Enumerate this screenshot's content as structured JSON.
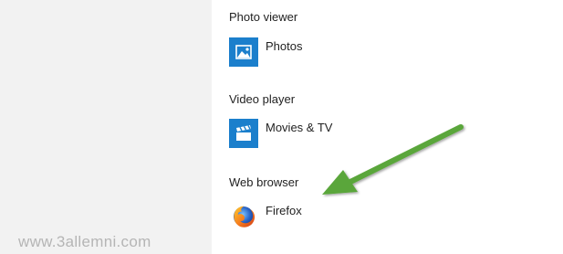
{
  "watermark": "www.3allemni.com",
  "sections": {
    "photo_viewer": {
      "label": "Photo viewer",
      "app": "Photos",
      "icon": "photos-icon"
    },
    "video_player": {
      "label": "Video player",
      "app": "Movies & TV",
      "icon": "movies-tv-icon"
    },
    "web_browser": {
      "label": "Web browser",
      "app": "Firefox",
      "icon": "firefox-icon"
    }
  },
  "colors": {
    "tile_accent": "#1b7fcc",
    "arrow": "#5aa63a",
    "sidebar_bg": "#f2f2f2"
  }
}
